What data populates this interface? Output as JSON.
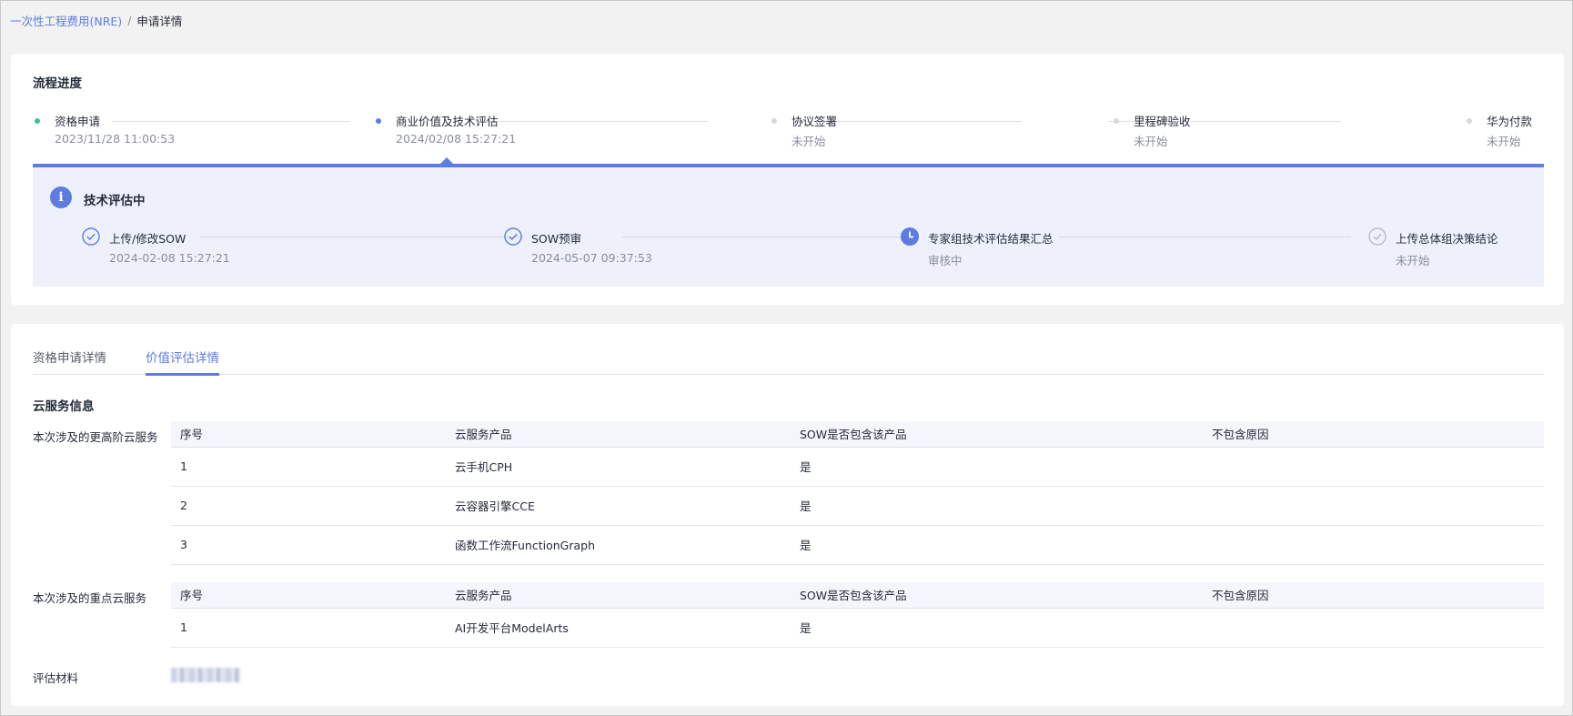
{
  "breadcrumb": {
    "parent": "一次性工程费用(NRE)",
    "separator": "/",
    "current": "申请详情"
  },
  "progress": {
    "title": "流程进度",
    "steps": [
      {
        "name": "资格申请",
        "time": "2023/11/28 11:00:53",
        "status": "done",
        "color": "#3ac295"
      },
      {
        "name": "商业价值及技术评估",
        "time": "2024/02/08 15:27:21",
        "status": "active",
        "color": "#5e7ce0"
      },
      {
        "name": "协议签署",
        "time": "未开始",
        "status": "pending",
        "color": "#d5d7dc"
      },
      {
        "name": "里程碑验收",
        "time": "未开始",
        "status": "pending",
        "color": "#d5d7dc"
      },
      {
        "name": "华为付款",
        "time": "未开始",
        "status": "pending",
        "color": "#d5d7dc"
      }
    ],
    "sub": {
      "icon": "info-icon",
      "title": "技术评估中",
      "steps": [
        {
          "name": "上传/修改SOW",
          "time": "2024-02-08 15:27:21",
          "status": "done",
          "icon": "check-circle-icon"
        },
        {
          "name": "SOW预审",
          "time": "2024-05-07 09:37:53",
          "status": "done",
          "icon": "check-circle-icon"
        },
        {
          "name": "专家组技术评估结果汇总",
          "time": "审核中",
          "status": "active",
          "icon": "clock-icon"
        },
        {
          "name": "上传总体组决策结论",
          "time": "未开始",
          "status": "pending",
          "icon": "check-circle-icon"
        }
      ]
    }
  },
  "tabs": [
    {
      "label": "资格申请详情",
      "active": false
    },
    {
      "label": "价值评估详情",
      "active": true
    }
  ],
  "cloud_service": {
    "title": "云服务信息",
    "columns": [
      "序号",
      "云服务产品",
      "SOW是否包含该产品",
      "不包含原因"
    ],
    "advanced": {
      "label": "本次涉及的更高阶云服务",
      "rows": [
        {
          "no": "1",
          "product": "云手机CPH",
          "included": "是",
          "reason": ""
        },
        {
          "no": "2",
          "product": "云容器引擎CCE",
          "included": "是",
          "reason": ""
        },
        {
          "no": "3",
          "product": "函数工作流FunctionGraph",
          "included": "是",
          "reason": ""
        }
      ]
    },
    "key": {
      "label": "本次涉及的重点云服务",
      "rows": [
        {
          "no": "1",
          "product": "AI开发平台ModelArts",
          "included": "是",
          "reason": ""
        }
      ]
    },
    "materials_label": "评估材料"
  }
}
